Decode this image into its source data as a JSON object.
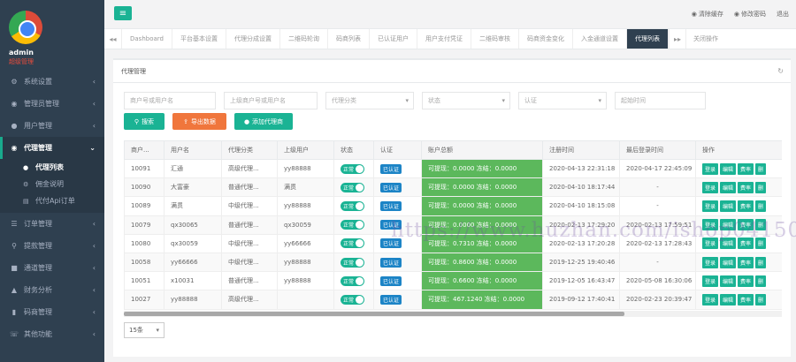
{
  "profile": {
    "name": "admin",
    "role": "超级管理"
  },
  "sidebar": {
    "items": [
      {
        "icon": "gear-icon",
        "glyph": "⚙",
        "label": "系统设置"
      },
      {
        "icon": "user-circle-icon",
        "glyph": "◉",
        "label": "管理员管理"
      },
      {
        "icon": "users-icon",
        "glyph": "●",
        "label": "用户管理"
      },
      {
        "icon": "eye-icon",
        "glyph": "◉",
        "label": "代理管理",
        "active": true
      },
      {
        "icon": "list-icon",
        "glyph": "☰",
        "label": "订单管理"
      },
      {
        "icon": "search-icon",
        "glyph": "⚲",
        "label": "提款管理"
      },
      {
        "icon": "briefcase-icon",
        "glyph": "■",
        "label": "通道管理"
      },
      {
        "icon": "chart-icon",
        "glyph": "▲",
        "label": "财务分析"
      },
      {
        "icon": "bars-icon",
        "glyph": "▮",
        "label": "码商管理"
      },
      {
        "icon": "phone-icon",
        "glyph": "☏",
        "label": "其他功能"
      }
    ],
    "subitems": [
      {
        "icon": "users-icon",
        "glyph": "●",
        "label": "代理列表",
        "current": true
      },
      {
        "icon": "gear-icon",
        "glyph": "⚙",
        "label": "佣金说明"
      },
      {
        "icon": "file-icon",
        "glyph": "▤",
        "label": "代付Api订单"
      }
    ]
  },
  "topbar": {
    "clear_cache": "清除缓存",
    "change_password": "修改密码",
    "logout": "退出"
  },
  "tabs": {
    "items": [
      "Dashboard",
      "平台基本设置",
      "代理分成设置",
      "二维码轮询",
      "码商列表",
      "已认证用户",
      "用户支付凭证",
      "二维码审核",
      "码商资金变化",
      "入金通道设置",
      "代理列表"
    ],
    "active_index": 10,
    "close_label": "关闭操作"
  },
  "panel": {
    "title": "代理管理"
  },
  "filters": {
    "merchant": "商户号或用户名",
    "parent": "上级商户号或用户名",
    "category": "代理分类",
    "status": "状态",
    "auth": "认证",
    "start_time": "起始时间"
  },
  "actions": {
    "search": "搜索",
    "export": "导出数据",
    "add": "添加代理商"
  },
  "table": {
    "headers": [
      "商户...",
      "用户名",
      "代理分类",
      "上级用户",
      "状态",
      "认证",
      "账户总额",
      "注册时间",
      "最后登录时间",
      "操作"
    ],
    "rows": [
      {
        "id": "10091",
        "user": "汇通",
        "category": "高级代理...",
        "parent": "yy88888",
        "balance": "可提现：0.0000 冻结：0.0000",
        "reg": "2020-04-13 22:31:18",
        "last": "2020-04-17 22:45:09"
      },
      {
        "id": "10090",
        "user": "大富豪",
        "category": "普通代理...",
        "parent": "满贯",
        "balance": "可提现：0.0000 冻结：0.0000",
        "reg": "2020-04-10 18:17:44",
        "last": "-"
      },
      {
        "id": "10089",
        "user": "满贯",
        "category": "中级代理...",
        "parent": "yy88888",
        "balance": "可提现：0.0000 冻结：0.0000",
        "reg": "2020-04-10 18:15:08",
        "last": "-"
      },
      {
        "id": "10079",
        "user": "qx30065",
        "category": "普通代理...",
        "parent": "qx30059",
        "balance": "可提现：0.0000 冻结：0.0000",
        "reg": "2020-02-13 17:29:20",
        "last": "2020-02-13 17:59:51"
      },
      {
        "id": "10080",
        "user": "qx30059",
        "category": "中级代理...",
        "parent": "yy66666",
        "balance": "可提现：0.7310 冻结：0.0000",
        "reg": "2020-02-13 17:20:28",
        "last": "2020-02-13 17:28:43"
      },
      {
        "id": "10058",
        "user": "yy66666",
        "category": "中级代理...",
        "parent": "yy88888",
        "balance": "可提现：0.8600 冻结：0.0000",
        "reg": "2019-12-25 19:40:46",
        "last": "-"
      },
      {
        "id": "10051",
        "user": "x10031",
        "category": "普通代理...",
        "parent": "yy88888",
        "balance": "可提现：0.6600 冻结：0.0000",
        "reg": "2019-12-05 16:43:47",
        "last": "2020-05-08 16:30:06"
      },
      {
        "id": "10027",
        "user": "yy88888",
        "category": "高级代理...",
        "parent": "",
        "balance": "可提现：467.1240 冻结：0.0000",
        "reg": "2019-09-12 17:40:41",
        "last": "2020-02-23 20:39:47"
      }
    ],
    "status_label": "正常",
    "auth_label": "已认证",
    "ops": [
      "登录",
      "编辑",
      "费率",
      "删"
    ]
  },
  "pager": {
    "size": "15条"
  },
  "watermark": "https://www.huzhan.com/ishop04150"
}
